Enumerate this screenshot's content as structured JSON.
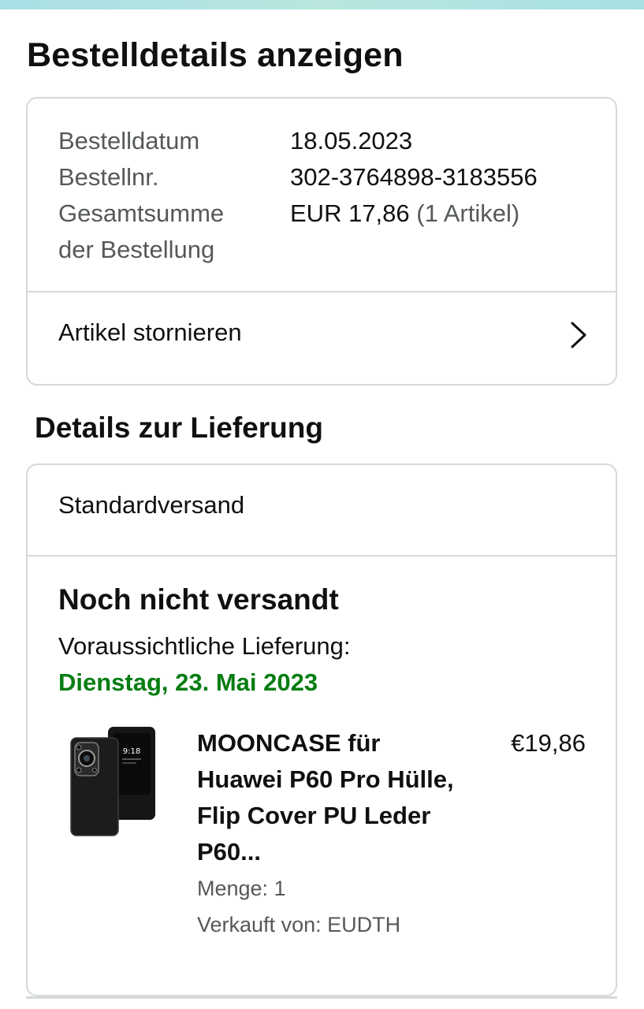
{
  "page": {
    "title": "Bestelldetails anzeigen"
  },
  "summary": {
    "order_date_label": "Bestelldatum",
    "order_date_value": "18.05.2023",
    "order_number_label": "Bestellnr.",
    "order_number_value": "302-3764898-3183556",
    "total_label_line1": "Gesamtsumme",
    "total_label_line2": "der Bestellung",
    "total_value": "EUR 17,86",
    "total_items": "(1 Artikel)",
    "cancel_label": "Artikel stornieren"
  },
  "delivery": {
    "section_title": "Details zur Lieferung",
    "shipping_method": "Standardversand",
    "status": "Noch nicht versandt",
    "eta_label": "Voraussichtliche Lieferung:",
    "eta_date": "Dienstag, 23. Mai 2023"
  },
  "product": {
    "title": "MOONCASE für Huawei P60 Pro Hülle, Flip Cover PU Leder P60...",
    "price": "€19,86",
    "quantity": "Menge: 1",
    "seller": "Verkauft von: EUDTH",
    "thumb_time": "9:18"
  },
  "colors": {
    "accent_green": "#067d12",
    "border": "#d5d9d9",
    "muted_text": "#565959"
  },
  "icons": {
    "chevron": "chevron-right-icon"
  }
}
